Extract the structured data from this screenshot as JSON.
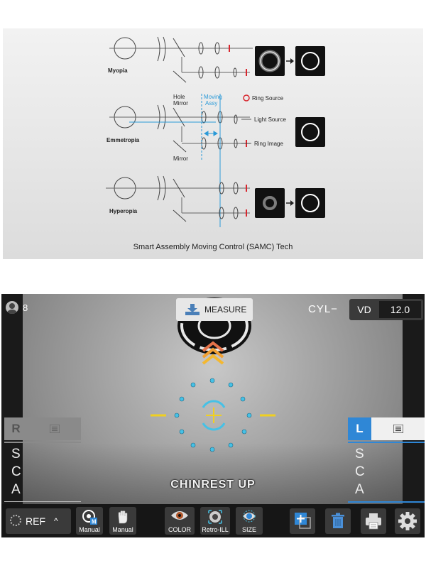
{
  "diagram": {
    "labels": {
      "myopia": "Myopia",
      "emmetropia": "Emmetropia",
      "hyperopia": "Hyperopia",
      "hole_mirror_1": "Hole",
      "hole_mirror_2": "Mirror",
      "moving_1": "Moving",
      "moving_2": "Assy",
      "ring_source": "Ring Source",
      "light_source": "Light Source",
      "ring_image": "Ring Image",
      "mirror": "Mirror"
    },
    "caption": "Smart Assembly Moving Control (SAMC) Tech",
    "colors": {
      "accent_blue": "#2b9ad8",
      "ring_red": "#d8262e"
    }
  },
  "device": {
    "user_count": "8",
    "measure_label": "MEASURE",
    "cyl_label": "CYL−",
    "vd_label": "VD",
    "vd_value": "12.0",
    "left_eye": {
      "label": "R",
      "letters": [
        "S",
        "C",
        "A"
      ]
    },
    "right_eye": {
      "label": "L",
      "letters": [
        "S",
        "C",
        "A"
      ]
    },
    "chinrest_label": "CHINREST UP",
    "toolbar": {
      "ref_label": "REF",
      "manual_focus_label": "Manual",
      "manual_hand_label": "Manual",
      "color_label": "COLOR",
      "retro_label": "Retro-ILL",
      "size_label": "SIZE",
      "focus_badge": "M"
    },
    "colors": {
      "accent": "#2f87d6",
      "target_cyan": "#46c1e6",
      "target_yellow": "#f0d020",
      "chevron": "#f2a033"
    }
  }
}
